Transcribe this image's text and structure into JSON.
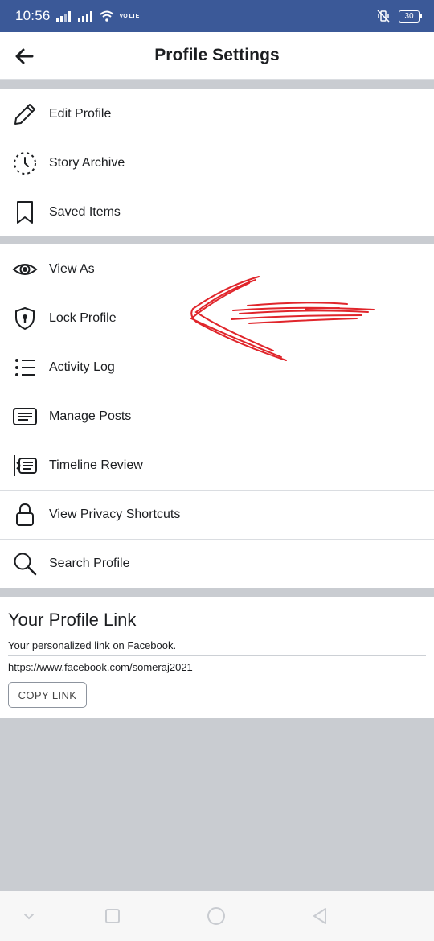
{
  "status_bar": {
    "time": "10:56",
    "volte": "VO LTE",
    "battery": "30"
  },
  "header": {
    "title": "Profile Settings"
  },
  "group1": [
    {
      "label": "Edit Profile",
      "icon": "pencil-icon"
    },
    {
      "label": "Story Archive",
      "icon": "story-archive-icon"
    },
    {
      "label": "Saved Items",
      "icon": "bookmark-icon"
    }
  ],
  "group2": [
    {
      "label": "View As",
      "icon": "eye-icon"
    },
    {
      "label": "Lock Profile",
      "icon": "shield-lock-icon"
    },
    {
      "label": "Activity Log",
      "icon": "list-icon"
    },
    {
      "label": "Manage Posts",
      "icon": "posts-icon"
    },
    {
      "label": "Timeline Review",
      "icon": "timeline-review-icon"
    },
    {
      "label": "View Privacy Shortcuts",
      "icon": "lock-icon"
    },
    {
      "label": "Search Profile",
      "icon": "search-icon"
    }
  ],
  "profile_link": {
    "title": "Your Profile Link",
    "description": "Your personalized link on Facebook.",
    "url": "https://www.facebook.com/someraj2021",
    "copy_label": "COPY LINK"
  },
  "colors": {
    "status_bar": "#3b5998",
    "background": "#c9ccd1",
    "annotation": "#e0252b"
  }
}
